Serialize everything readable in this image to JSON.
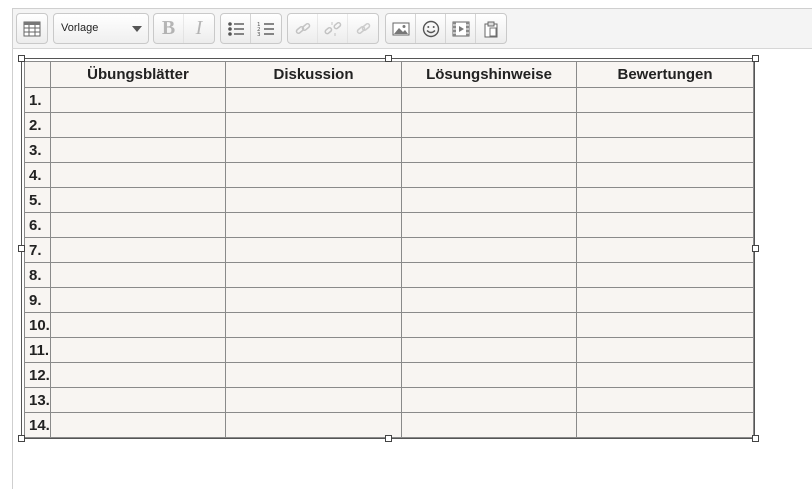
{
  "toolbar": {
    "format_select": {
      "value": "Vorlage"
    },
    "buttons": [
      {
        "name": "table-button",
        "icon": "table-icon"
      },
      {
        "name": "bold-button",
        "icon": "bold-icon",
        "glyph": "B"
      },
      {
        "name": "italic-button",
        "icon": "italic-icon",
        "glyph": "I"
      },
      {
        "name": "bullet-list-button",
        "icon": "bullet-list-icon"
      },
      {
        "name": "numbered-list-button",
        "icon": "numbered-list-icon"
      },
      {
        "name": "link-button",
        "icon": "link-icon"
      },
      {
        "name": "unlink-button",
        "icon": "unlink-icon"
      },
      {
        "name": "anchor-button",
        "icon": "anchor-icon"
      },
      {
        "name": "image-button",
        "icon": "image-icon"
      },
      {
        "name": "emoticon-button",
        "icon": "smiley-icon"
      },
      {
        "name": "media-button",
        "icon": "film-icon"
      },
      {
        "name": "paste-button",
        "icon": "paste-icon"
      }
    ]
  },
  "table": {
    "headers": [
      "",
      "Übungsblätter",
      "Diskussion",
      "Lösungshinweise",
      "Bewertungen"
    ],
    "rows": [
      "1.",
      "2.",
      "3.",
      "4.",
      "5.",
      "6.",
      "7.",
      "8.",
      "9.",
      "10.",
      "11.",
      "12.",
      "13.",
      "14."
    ]
  },
  "colors": {
    "table_background": "#f8f5f2",
    "toolbar_background": "#f4f4f4",
    "grid_line": "#8a8a8a"
  }
}
